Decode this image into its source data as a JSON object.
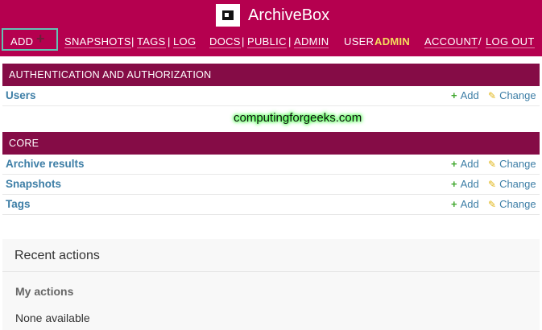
{
  "header": {
    "app_title": "ArchiveBox",
    "logo_icon": "archive-box-icon",
    "nav": {
      "add_label": "ADD",
      "add_icon": "plus-icon",
      "snapshots": "SNAPSHOTS",
      "tags": "TAGS",
      "log": "LOG",
      "docs": "DOCS",
      "public": "PUBLIC",
      "admin": "ADMIN",
      "user_label": "USER",
      "user_name": "ADMIN",
      "account": "ACCOUNT",
      "logout": "LOG OUT",
      "separator": "|",
      "slash": "/"
    }
  },
  "modules": [
    {
      "caption": "AUTHENTICATION AND AUTHORIZATION",
      "rows": [
        {
          "name": "Users",
          "add": "Add",
          "change": "Change"
        }
      ]
    },
    {
      "caption": "CORE",
      "rows": [
        {
          "name": "Archive results",
          "add": "Add",
          "change": "Change"
        },
        {
          "name": "Snapshots",
          "add": "Add",
          "change": "Change"
        },
        {
          "name": "Tags",
          "add": "Add",
          "change": "Change"
        }
      ]
    }
  ],
  "watermark": "computingforgeeks.com",
  "recent_actions": {
    "title": "Recent actions",
    "subtitle": "My actions",
    "empty_text": "None available"
  },
  "colors": {
    "header_bg": "#b5004f",
    "module_caption_bg": "#850c46",
    "link": "#3d7ea6",
    "user_name": "#f5dd5d",
    "add_icon": "#42a830",
    "change_icon": "#e0b515",
    "add_box_border": "#63c2b3"
  }
}
